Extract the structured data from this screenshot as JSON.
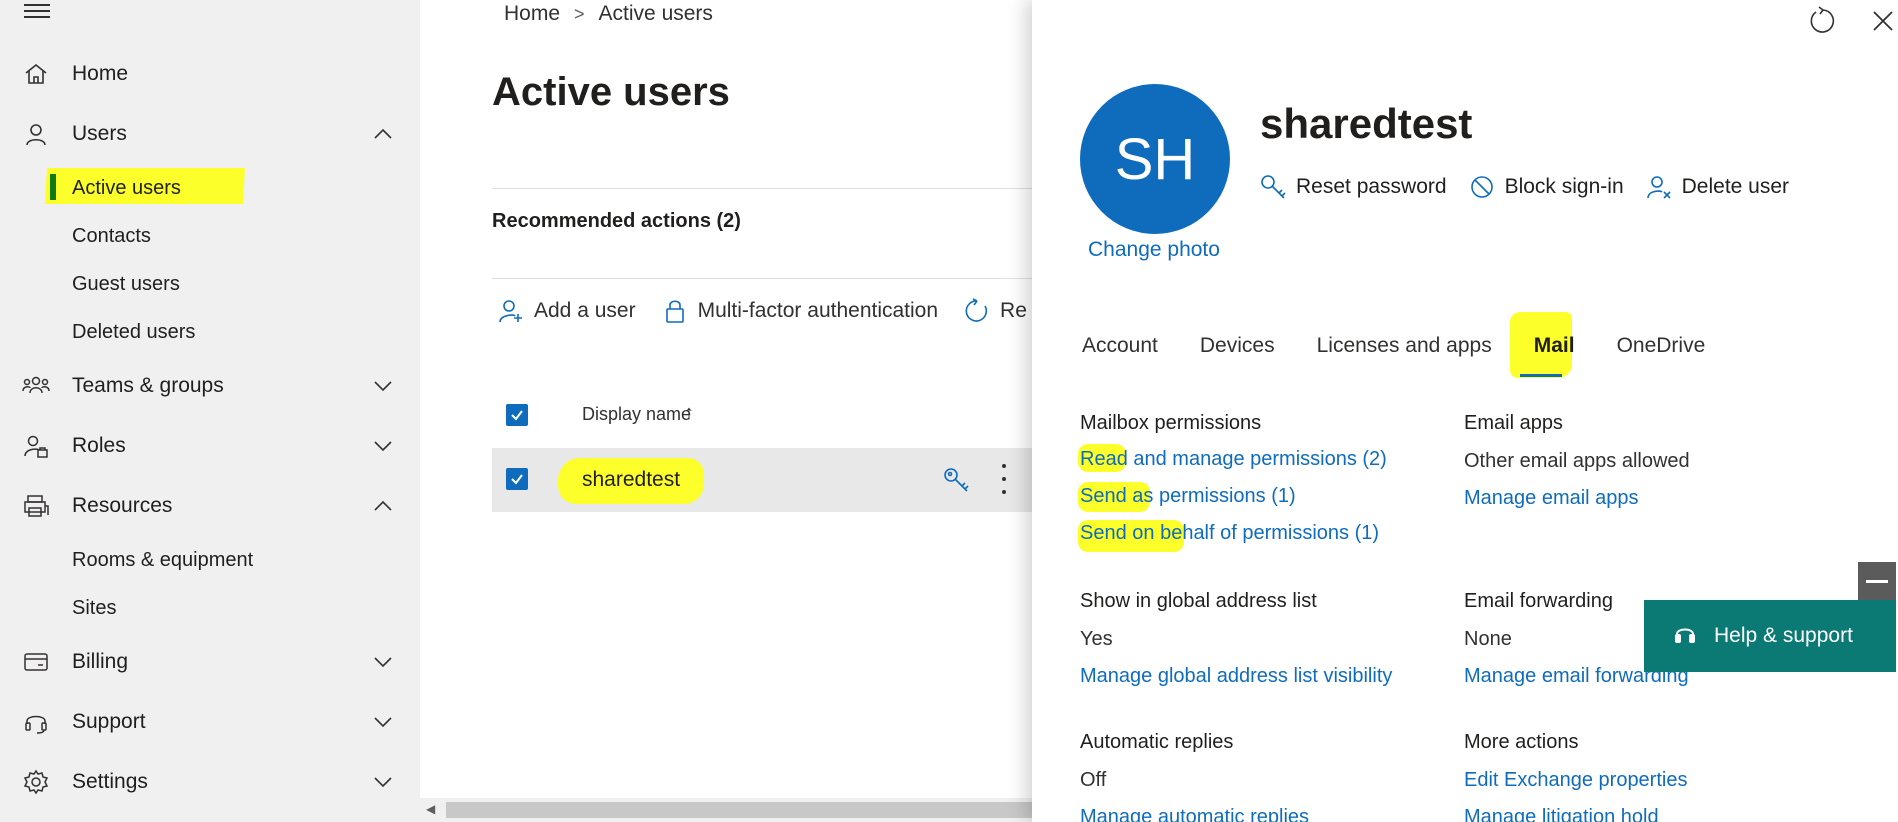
{
  "sidebar": {
    "items": [
      {
        "label": "Home"
      },
      {
        "label": "Users"
      },
      {
        "label": "Active users"
      },
      {
        "label": "Contacts"
      },
      {
        "label": "Guest users"
      },
      {
        "label": "Deleted users"
      },
      {
        "label": "Teams & groups"
      },
      {
        "label": "Roles"
      },
      {
        "label": "Resources"
      },
      {
        "label": "Rooms & equipment"
      },
      {
        "label": "Sites"
      },
      {
        "label": "Billing"
      },
      {
        "label": "Support"
      },
      {
        "label": "Settings"
      }
    ]
  },
  "main": {
    "breadcrumb": {
      "home": "Home",
      "sep": ">",
      "current": "Active users"
    },
    "title": "Active users",
    "recommended": "Recommended actions (2)",
    "toolbar": {
      "add_user": "Add a user",
      "mfa": "Multi-factor authentication",
      "refresh": "Re"
    },
    "table": {
      "header": "Display name",
      "sort_indicator": "↑",
      "rows": [
        {
          "name": "sharedtest"
        }
      ]
    }
  },
  "panel": {
    "avatar_initials": "SH",
    "change_photo": "Change photo",
    "user_name": "sharedtest",
    "actions": {
      "reset": "Reset password",
      "block": "Block sign-in",
      "delete": "Delete user"
    },
    "tabs": [
      "Account",
      "Devices",
      "Licenses and apps",
      "Mail",
      "OneDrive"
    ],
    "active_tab": "Mail",
    "mailbox_permissions": {
      "title": "Mailbox permissions",
      "read": "Read and manage permissions (2)",
      "send_as": "Send as permissions (1)",
      "send_on_behalf": "Send on behalf of permissions (1)"
    },
    "email_apps": {
      "title": "Email apps",
      "value": "Other email apps allowed",
      "link": "Manage email apps"
    },
    "global_address": {
      "title": "Show in global address list",
      "value": "Yes",
      "link": "Manage global address list visibility"
    },
    "email_forwarding": {
      "title": "Email forwarding",
      "value": "None",
      "link": "Manage email forwarding"
    },
    "automatic_replies": {
      "title": "Automatic replies",
      "value": "Off",
      "link": "Manage automatic replies"
    },
    "more_actions": {
      "title": "More actions",
      "link1": "Edit Exchange properties",
      "link2": "Manage litigation hold"
    }
  },
  "help": {
    "label": "Help & support"
  },
  "colors": {
    "accent": "#0f6cbd",
    "highlight": "#fcff2a",
    "help": "#0b7a75",
    "active_bar": "#107c10"
  }
}
